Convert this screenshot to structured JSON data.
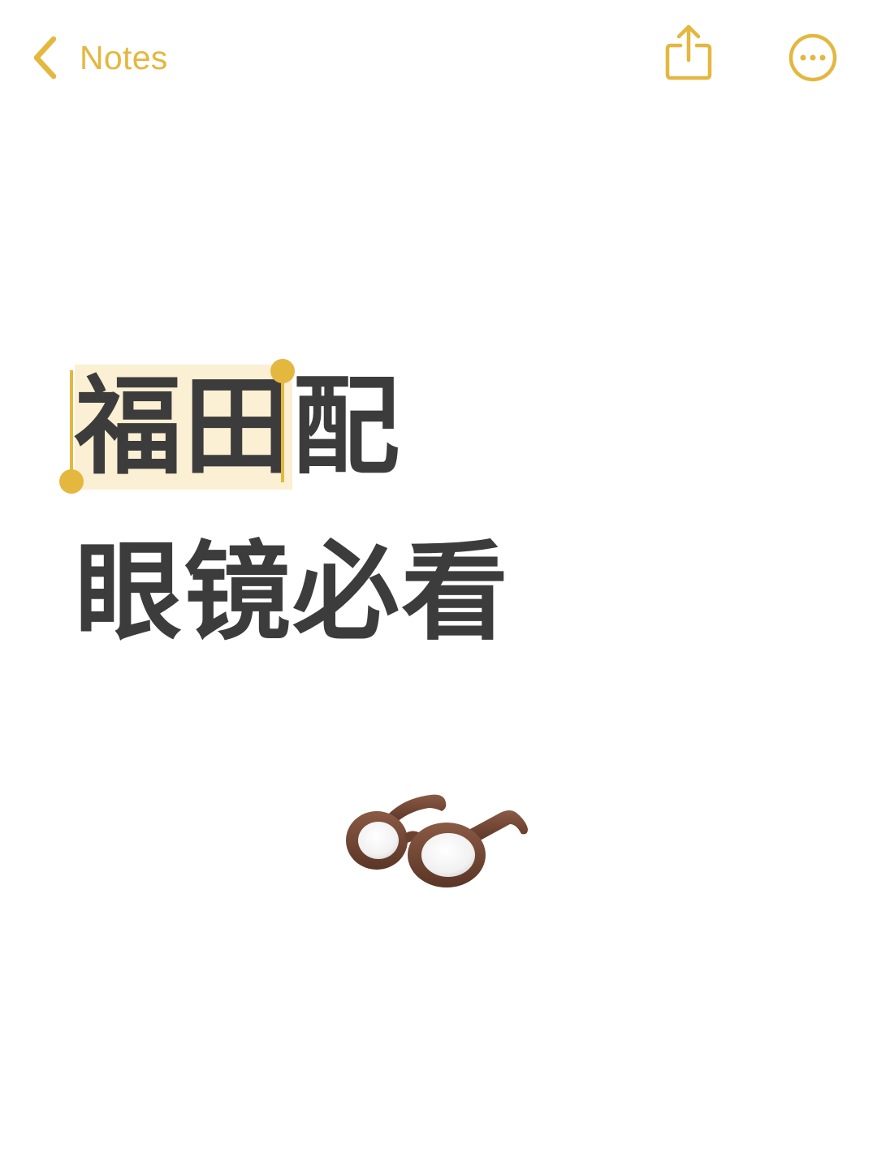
{
  "nav": {
    "back_label": "Notes",
    "back_icon": "chevron-left-icon",
    "share_icon": "share-icon",
    "more_icon": "ellipsis-circle-icon"
  },
  "note": {
    "selected_text": "福田",
    "line1_rest": "配",
    "line2": "眼镜必看",
    "emoji": "glasses-icon"
  },
  "colors": {
    "accent": "#E4B73F",
    "selection": "#FBF0D3",
    "text": "#3C3C3C"
  }
}
